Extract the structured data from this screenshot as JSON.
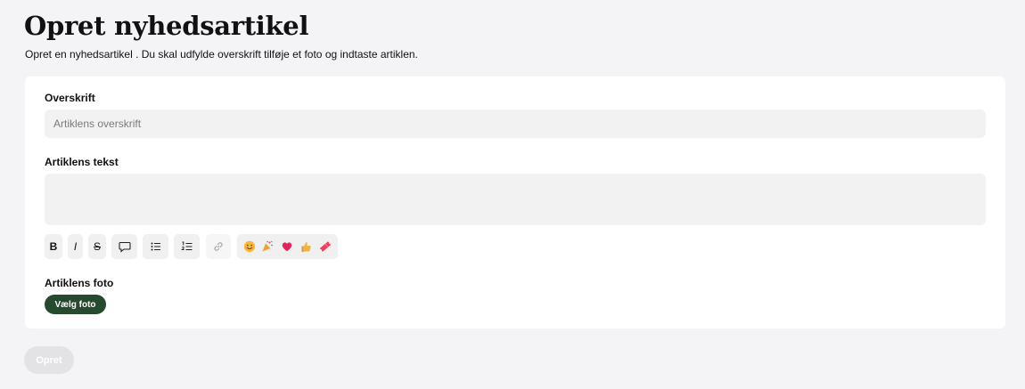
{
  "page": {
    "title": "Opret nyhedsartikel",
    "subtitle": "Opret en nyhedsartikel . Du skal udfylde overskrift tilføje et foto og indtaste artiklen."
  },
  "form": {
    "headline_label": "Overskrift",
    "headline_placeholder": "Artiklens overskrift",
    "headline_value": "",
    "body_label": "Artiklens tekst",
    "body_value": "",
    "photo_label": "Artiklens foto",
    "choose_photo_label": "Vælg foto",
    "submit_label": "Opret"
  },
  "toolbar": {
    "bold_label": "B",
    "italic_label": "I",
    "strike_label": "S",
    "icons": [
      "comment-icon",
      "bullet-list-icon",
      "numbered-list-icon",
      "link-icon"
    ],
    "emojis": [
      "smile-emoji-icon",
      "party-popper-emoji-icon",
      "heart-emoji-icon",
      "thumbs-up-emoji-icon",
      "ticket-emoji-icon"
    ]
  },
  "colors": {
    "page_background": "#f4f4f6",
    "card_background": "#ffffff",
    "input_background": "#f2f2f3",
    "choose_photo_button": "#264a2e",
    "submit_button_disabled": "#e3e3e5"
  }
}
